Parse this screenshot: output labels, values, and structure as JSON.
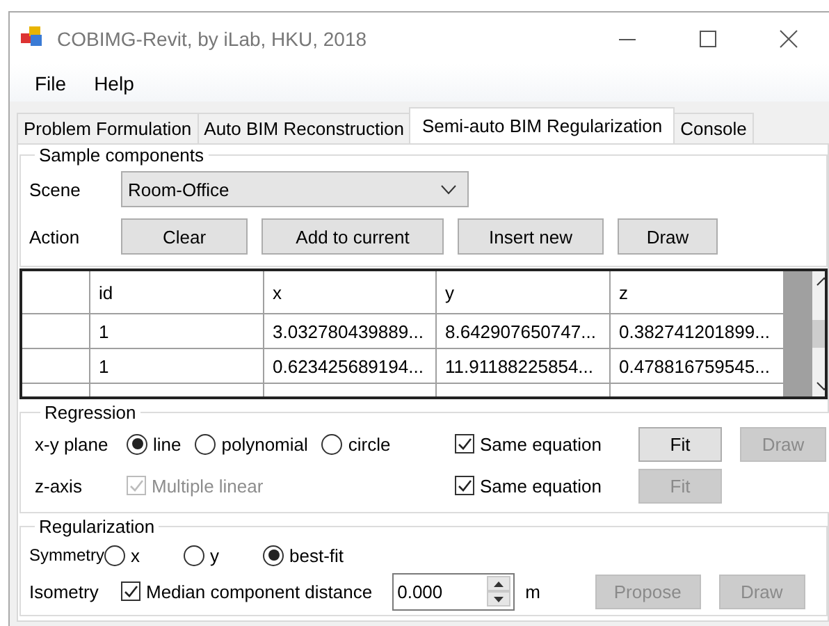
{
  "window": {
    "title": "COBIMG-Revit, by iLab, HKU, 2018"
  },
  "menu": [
    "File",
    "Help"
  ],
  "tabs": [
    {
      "label": "Problem Formulation",
      "selected": false
    },
    {
      "label": "Auto BIM Reconstruction",
      "selected": false
    },
    {
      "label": "Semi-auto BIM Regularization",
      "selected": true
    },
    {
      "label": "Console",
      "selected": false
    }
  ],
  "sample_components": {
    "title": "Sample components",
    "scene": {
      "label": "Scene",
      "value": "Room-Office"
    },
    "action": {
      "label": "Action",
      "buttons": [
        {
          "label": "Clear",
          "disabled": false
        },
        {
          "label": "Add to current",
          "disabled": false
        },
        {
          "label": "Insert new",
          "disabled": false
        },
        {
          "label": "Draw",
          "disabled": false
        }
      ]
    }
  },
  "grid": {
    "columns": [
      "id",
      "x",
      "y",
      "z"
    ],
    "rows": [
      [
        "1",
        "3.032780439889...",
        "8.642907650747...",
        "0.382741201899..."
      ],
      [
        "1",
        "0.623425689194...",
        "11.91188225854...",
        "0.478816759545..."
      ]
    ]
  },
  "regression": {
    "title": "Regression",
    "xy_plane": {
      "label": "x-y plane",
      "options": [
        {
          "label": "line",
          "selected": true
        },
        {
          "label": "polynomial",
          "selected": false
        },
        {
          "label": "circle",
          "selected": false
        }
      ],
      "same_equation": {
        "label": "Same equation",
        "checked": true
      },
      "fit": {
        "label": "Fit",
        "disabled": false
      },
      "draw": {
        "label": "Draw",
        "disabled": true
      }
    },
    "z_axis": {
      "label": "z-axis",
      "multiple_linear": {
        "label": "Multiple linear",
        "checked": true,
        "disabled": true
      },
      "same_equation": {
        "label": "Same equation",
        "checked": true
      },
      "fit": {
        "label": "Fit",
        "disabled": true
      }
    }
  },
  "regularization": {
    "title": "Regularization",
    "symmetry": {
      "label": "Symmetry",
      "options": [
        {
          "label": "x",
          "selected": false
        },
        {
          "label": "y",
          "selected": false
        },
        {
          "label": "best-fit",
          "selected": true
        }
      ]
    },
    "isometry": {
      "label": "Isometry",
      "median": {
        "label": "Median component distance",
        "checked": true
      },
      "value": "0.000",
      "unit": "m",
      "propose": {
        "label": "Propose",
        "disabled": true
      },
      "draw": {
        "label": "Draw",
        "disabled": true
      }
    }
  }
}
